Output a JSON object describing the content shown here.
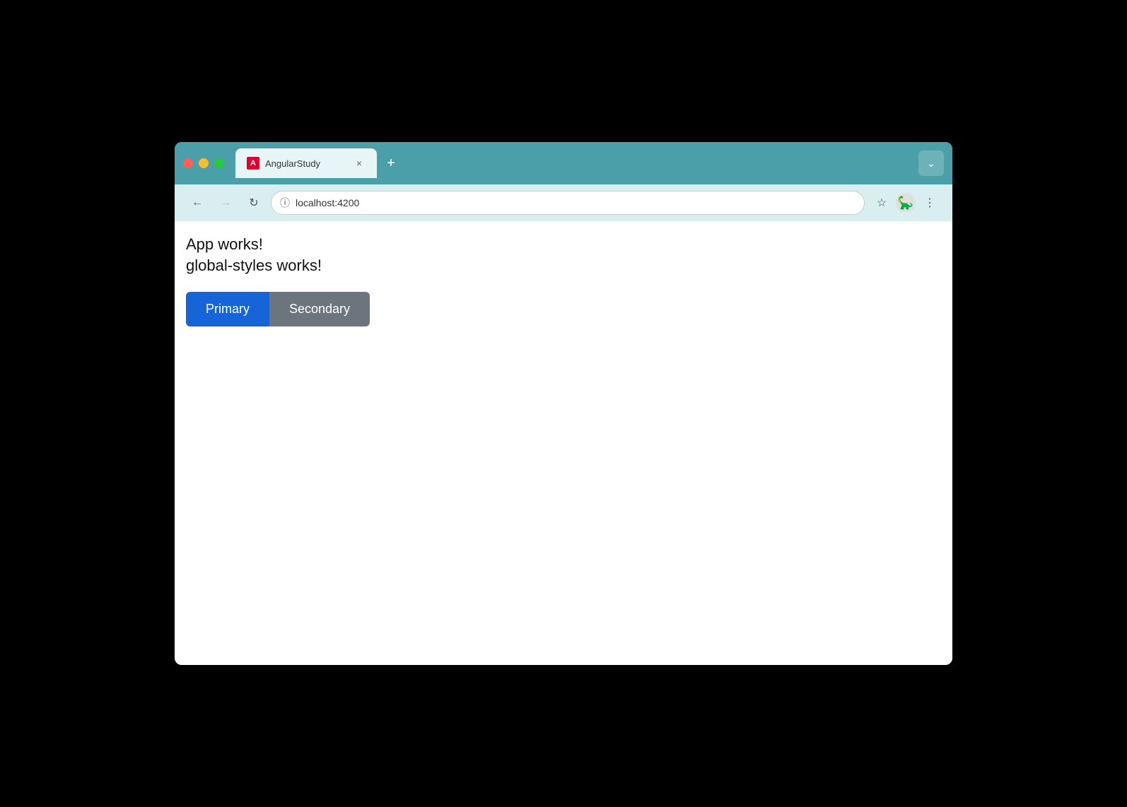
{
  "browser": {
    "tab": {
      "favicon_label": "A",
      "title": "AngularStudy",
      "close_label": "×"
    },
    "new_tab_label": "+",
    "expand_label": "⌄"
  },
  "navbar": {
    "back_label": "←",
    "forward_label": "→",
    "reload_label": "↻",
    "address": "localhost:4200",
    "bookmark_label": "☆",
    "menu_label": "⋮"
  },
  "page": {
    "line1": "App works!",
    "line2": "global-styles works!",
    "primary_button": "Primary",
    "secondary_button": "Secondary"
  }
}
